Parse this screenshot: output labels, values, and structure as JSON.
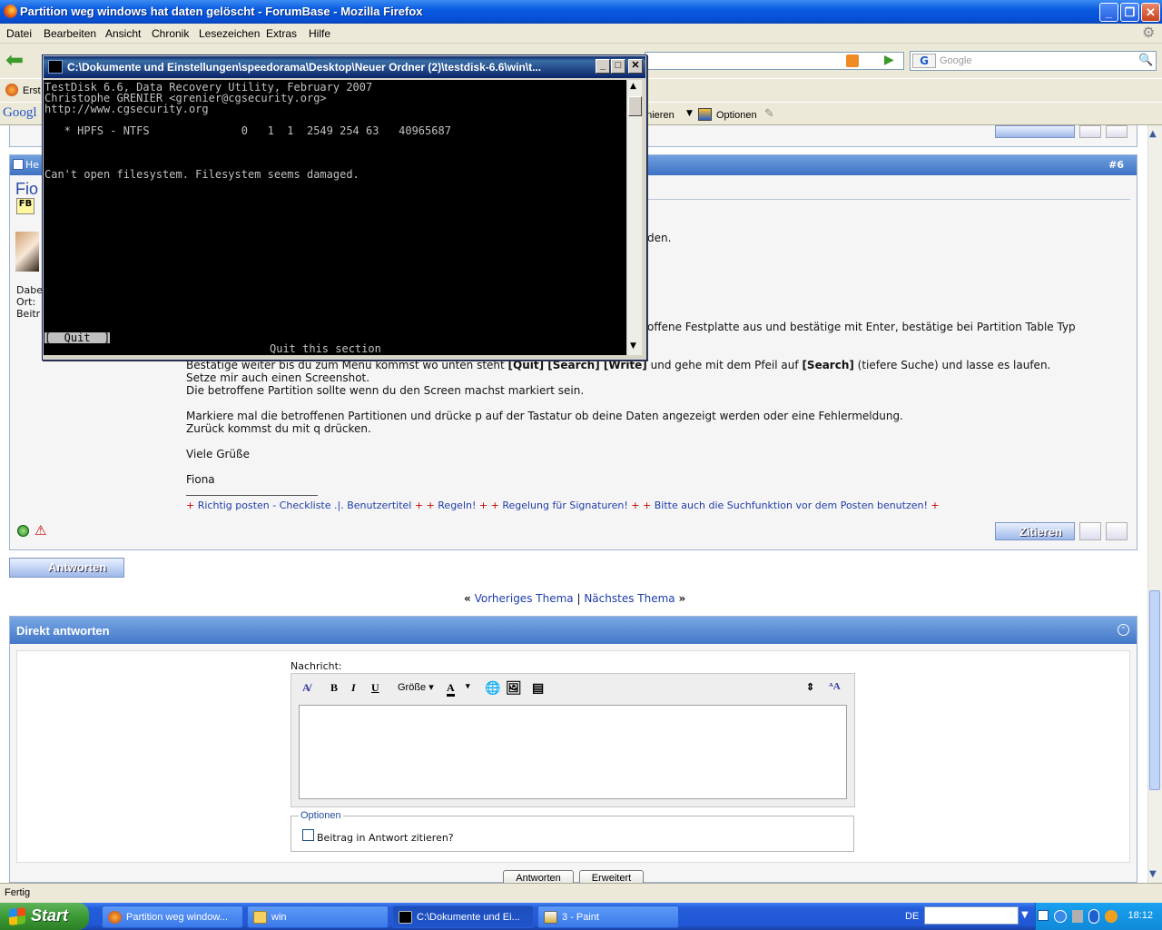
{
  "firefox": {
    "title": "Partition weg windows hat daten gelöscht - ForumBase - Mozilla Firefox",
    "menu": [
      "Datei",
      "Bearbeiten",
      "Ansicht",
      "Chronik",
      "Lesezeichen",
      "Extras",
      "Hilfe"
    ],
    "search_placeholder": "Google",
    "bookmark_first": "Erst",
    "google_label": "Googl",
    "toolbar_partial": "nnieren",
    "toolbar_options": "Optionen",
    "status": "Fertig"
  },
  "console": {
    "title": "C:\\Dokumente und Einstellungen\\speedorama\\Desktop\\Neuer Ordner (2)\\testdisk-6.6\\win\\t...",
    "lines": [
      "TestDisk 6.6, Data Recovery Utility, February 2007",
      "Christophe GRENIER <grenier@cgsecurity.org>",
      "http://www.cgsecurity.org"
    ],
    "partition_row": "   * HPFS - NTFS              0   1  1  2549 254 63   40965687",
    "error": "Can't open filesystem. Filesystem seems damaged.",
    "quit_menu": "[  Quit  ]",
    "quit_hint": "Quit this section"
  },
  "post": {
    "number": "#6",
    "author_partial": "Fio",
    "head_partial": "He",
    "meta_dabei": "Dabe",
    "meta_ort": "Ort:",
    "meta_beitr": "Beitr",
    "line_partial1": "den.",
    "line_partial2": "offene Festplatte aus und bestätige mit Enter, bestätige bei Partition Table Typ",
    "line3_pre": "Bestätige weiter bis du zum Menü kommst wo unten steht ",
    "line3_b1": "[Quit] [Search] [Write]",
    "line3_mid": " und gehe mit dem Pfeil auf ",
    "line3_b2": "[Search]",
    "line3_post": " (tiefere Suche) und lasse es laufen.",
    "line4": "Setze mir auch einen Screenshot.",
    "line5": "Die betroffene Partition sollte wenn du den Screen machst markiert sein.",
    "line6": "Markiere mal die betroffenen Partitionen und drücke p auf der Tastatur ob deine Daten angezeigt werden oder eine Fehlermeldung.",
    "line7": "Zurück kommst du mit q drücken.",
    "line8": "Viele Grüße",
    "line9": "Fiona",
    "signature": [
      "Richtig posten - Checkliste .|. Benutzertitel",
      "Regeln!",
      "Regelung für Signaturen!",
      "Bitte auch die Suchfunktion vor dem Posten benutzen!"
    ],
    "quote_button": "Zitieren"
  },
  "nav": {
    "reply_button": "Antworten",
    "prev": "Vorheriges Thema",
    "sep": "|",
    "next": "Nächstes Thema",
    "laquo": "«",
    "raquo": "»"
  },
  "reply": {
    "title": "Direkt antworten",
    "message_label": "Nachricht:",
    "size_label": "Größe",
    "options_legend": "Optionen",
    "quote_checkbox": "Beitrag in Antwort zitieren?",
    "submit": "Antworten",
    "advanced": "Erweitert"
  },
  "taskbar": {
    "start": "Start",
    "tasks": [
      "Partition weg window...",
      "win",
      "C:\\Dokumente und Ei...",
      "3 - Paint"
    ],
    "lang": "DE",
    "clock": "18:12"
  }
}
